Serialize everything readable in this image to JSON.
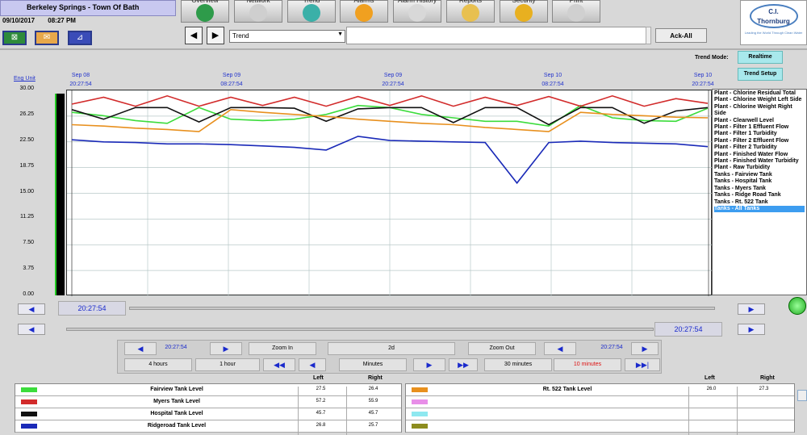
{
  "header": {
    "title": "Berkeley Springs - Town Of Bath",
    "date": "09/10/2017",
    "time": "08:27 PM"
  },
  "nav_tabs": [
    {
      "label": "Overview",
      "icon": "globe-icon"
    },
    {
      "label": "Network",
      "icon": "network-icon"
    },
    {
      "label": "Trend",
      "icon": "trend-icon"
    },
    {
      "label": "Alarms",
      "icon": "bell-icon"
    },
    {
      "label": "Alarm History",
      "icon": "alarm-history-icon"
    },
    {
      "label": "Reports",
      "icon": "folder-icon"
    },
    {
      "label": "Security",
      "icon": "lock-icon"
    },
    {
      "label": "Print",
      "icon": "printer-icon"
    }
  ],
  "toolbar": {
    "trend_select_value": "Trend",
    "ack_all_label": "Ack-All"
  },
  "logo": {
    "line1": "C.I.",
    "line2": "Thornburg",
    "tagline": "Leading the World Through Clean Water"
  },
  "trend_mode": {
    "label": "Trend Mode:",
    "mode_button": "Realtime",
    "setup_button": "Trend Setup"
  },
  "chart_data": {
    "type": "line",
    "ylabel": "Eng Unit",
    "ylim": [
      0,
      30
    ],
    "y_ticks": [
      "30.00",
      "26.25",
      "22.50",
      "18.75",
      "15.00",
      "11.25",
      "7.50",
      "3.75",
      "0.00"
    ],
    "x_ticks": [
      {
        "date": "Sep 08",
        "time": "20:27:54"
      },
      {
        "date": "Sep 09",
        "time": "08:27:54"
      },
      {
        "date": "Sep 09",
        "time": "20:27:54"
      },
      {
        "date": "Sep 10",
        "time": "08:27:54"
      },
      {
        "date": "Sep 10",
        "time": "20:27:54"
      }
    ],
    "grid": true,
    "series": [
      {
        "name": "Fairview Tank Level",
        "color": "#3cdc3c",
        "values": [
          26.8,
          26.3,
          25.6,
          25.2,
          27.5,
          25.8,
          25.6,
          25.8,
          26.5,
          27.8,
          27.5,
          26.5,
          26.0,
          25.5,
          25.5,
          24.8,
          27.8,
          26.0,
          25.6,
          25.5,
          27.4
        ]
      },
      {
        "name": "Myers Tank Level",
        "color": "#d22b2b",
        "values": [
          28.0,
          29.0,
          27.7,
          29.2,
          27.7,
          29.0,
          27.8,
          29.0,
          27.7,
          29.1,
          27.8,
          29.2,
          27.7,
          29.0,
          27.8,
          29.1,
          27.7,
          29.2,
          27.7,
          28.8,
          28.1
        ]
      },
      {
        "name": "Hospital Tank Level",
        "color": "#111111",
        "values": [
          27.2,
          25.8,
          27.5,
          27.5,
          25.4,
          27.5,
          27.5,
          27.4,
          25.5,
          27.3,
          27.5,
          27.5,
          25.3,
          27.5,
          27.5,
          25.0,
          27.5,
          27.5,
          25.2,
          27.0,
          27.5
        ]
      },
      {
        "name": "Ridgeroad Tank Level",
        "color": "#1a2ab8",
        "values": [
          22.8,
          22.5,
          22.4,
          22.2,
          22.2,
          22.1,
          21.9,
          21.7,
          21.3,
          23.3,
          22.7,
          22.6,
          22.5,
          22.4,
          16.5,
          22.4,
          22.6,
          22.4,
          22.3,
          22.2,
          21.8
        ]
      },
      {
        "name": "Rt. 522 Tank Level",
        "color": "#e8901e",
        "values": [
          25.0,
          24.8,
          24.5,
          24.3,
          24.0,
          27.2,
          26.8,
          26.5,
          26.2,
          25.8,
          25.5,
          25.2,
          25.0,
          24.6,
          24.3,
          24.0,
          26.8,
          26.5,
          26.3,
          26.1,
          26.0
        ]
      }
    ]
  },
  "trend_list": [
    "Plant - Chlorine Residual Total",
    "Plant - Chlorine Weight Left Side",
    "Plant - Chlorine Weight Right Side",
    "Plant - Clearwell Level",
    "Plant - Filter 1 Effluent Flow",
    "Plant - Filter 1 Turbidity",
    "Plant - Filter 2 Effluent Flow",
    "Plant - Filter 2 Turbidity",
    "Plant - Finished Water Flow",
    "Plant - Finished Water Turbidity",
    "Plant - Raw Turbidity",
    "Tanks - Fairview Tank",
    "Tanks - Hospital Tank",
    "Tanks - Myers Tank",
    "Tanks - Ridge Road Tank",
    "Tanks - Rt. 522 Tank",
    "Tanks - All Tanks"
  ],
  "cursor_times": {
    "left_cursor": "20:27:54",
    "right_cursor": "20:27:54"
  },
  "controls": {
    "left_time": "20:27:54",
    "zoom_in": "Zoom In",
    "span": "2d",
    "zoom_out": "Zoom Out",
    "right_time": "20:27:54",
    "hours4": "4 hours",
    "hour1": "1 hour",
    "minutes": "Minutes",
    "min30": "30 minutes",
    "min10": "10 minutes"
  },
  "table": {
    "left_header": "Left",
    "right_header": "Right",
    "rows_left": [
      {
        "name": "Fairview Tank Level",
        "color": "#3cdc3c",
        "left": "27.5",
        "right": "26.4"
      },
      {
        "name": "Myers Tank Level",
        "color": "#d22b2b",
        "left": "57.2",
        "right": "55.9"
      },
      {
        "name": "Hospital Tank Level",
        "color": "#111111",
        "left": "45.7",
        "right": "45.7"
      },
      {
        "name": "Ridgeroad Tank Level",
        "color": "#1a2ab8",
        "left": "26.8",
        "right": "25.7"
      }
    ],
    "rows_right": [
      {
        "name": "Rt. 522 Tank Level",
        "color": "#e8901e",
        "left": "26.0",
        "right": "27.3"
      },
      {
        "name": "",
        "color": "#e88ee8",
        "left": "",
        "right": ""
      },
      {
        "name": "",
        "color": "#8ee8f0",
        "left": "",
        "right": ""
      },
      {
        "name": "",
        "color": "#8c8c1e",
        "left": "",
        "right": ""
      }
    ]
  }
}
